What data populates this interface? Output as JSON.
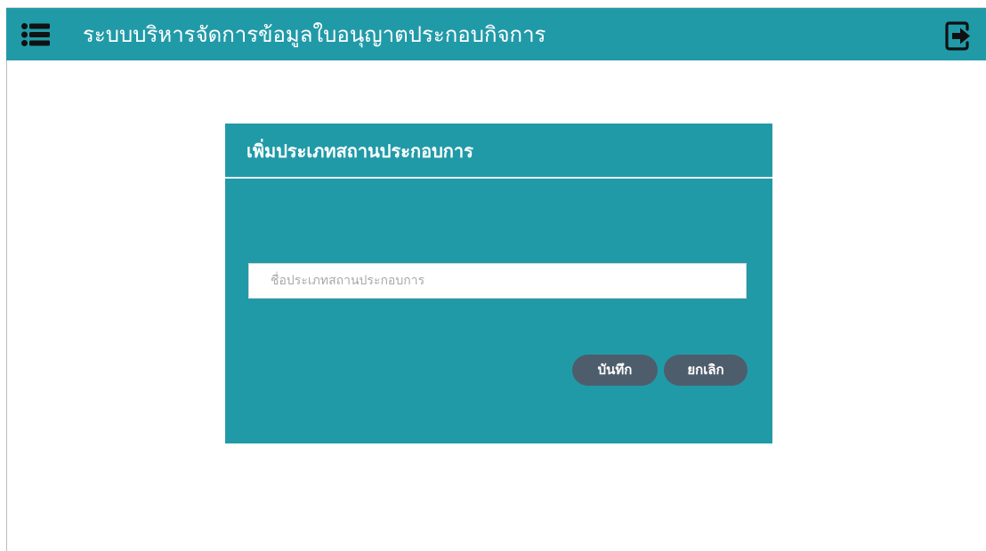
{
  "header": {
    "title": "ระบบบริหารจัดการข้อมูลใบอนุญาตประกอบกิจการ",
    "menu_icon": "menu-list-icon",
    "logout_icon": "logout-icon",
    "background_color": "#219aa8"
  },
  "dialog": {
    "title": "เพิ่มประเภทสถานประกอบการ",
    "name_field": {
      "placeholder": "ชื่อประเภทสถานประกอบการ",
      "value": ""
    },
    "save_label": "บันทึก",
    "cancel_label": "ยกเลิก",
    "background_color": "#219aa8",
    "button_color": "#4e5d6c"
  }
}
